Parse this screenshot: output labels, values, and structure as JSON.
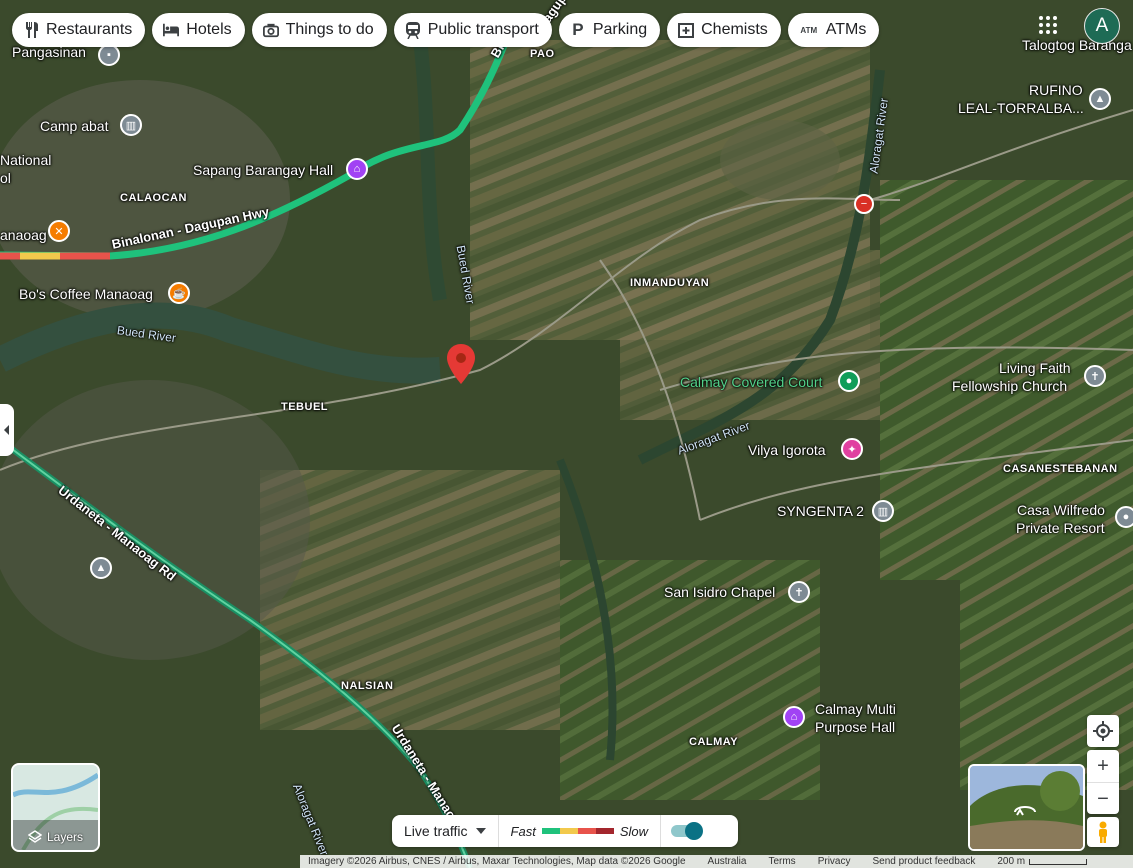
{
  "chips": [
    {
      "label": "Restaurants",
      "icon": "restaurant-icon"
    },
    {
      "label": "Hotels",
      "icon": "hotel-icon"
    },
    {
      "label": "Things to do",
      "icon": "camera-icon"
    },
    {
      "label": "Public transport",
      "icon": "train-icon"
    },
    {
      "label": "Parking",
      "icon": "parking-icon"
    },
    {
      "label": "Chemists",
      "icon": "pharmacy-icon"
    },
    {
      "label": "ATMs",
      "icon": "atm-icon"
    }
  ],
  "account": {
    "initial": "A"
  },
  "places": {
    "pangasinan": "Pangasinan",
    "camp_abat": "Camp abat",
    "national": "National",
    "national_2": "ol",
    "sapang": "Sapang Barangay Hall",
    "manaoag": "anaoag",
    "bos_coffee": "Bo's Coffee Manaoag",
    "talogtog": "Talogtog Baranga",
    "rufino_1": "RUFINO",
    "rufino_2": "LEAL-TORRALBA...",
    "calmay_court": "Calmay Covered Court",
    "living_faith_1": "Living Faith",
    "living_faith_2": "Fellowship Church",
    "vilya": "Vilya Igorota",
    "syngenta": "SYNGENTA 2",
    "casa_1": "Casa Wilfredo",
    "casa_2": "Private Resort",
    "san_isidro": "San Isidro Chapel",
    "calmay_hall_1": "Calmay Multi",
    "calmay_hall_2": "Purpose Hall"
  },
  "areas": {
    "pao": "PAO",
    "calaocan": "CALAOCAN",
    "inmanduyan": "INMANDUYAN",
    "tebuel": "TEBUEL",
    "casanestebanan": "CASANESTEBANAN",
    "nalsian": "NALSIAN",
    "calmay": "CALMAY"
  },
  "roads": {
    "binalonan_top": "Bin",
    "binalonan_main": "Binalonan - Dagupan Hwy",
    "dagupan_top": "Dagup",
    "urdaneta_1": "Urdaneta - Manaoag Rd",
    "urdaneta_2": "Urdaneta - Manaoa"
  },
  "rivers": {
    "bued_1": "Bued River",
    "bued_2": "Bued River",
    "aloragat_1": "Aloragat River",
    "aloragat_2": "Aloragat River",
    "aloragat_3": "Aloragat River"
  },
  "layers_label": "Layers",
  "traffic": {
    "dropdown": "Live traffic",
    "fast": "Fast",
    "slow": "Slow",
    "toggle_on": true,
    "scale_colors": [
      "#1fc27c",
      "#f2c94c",
      "#e8534b",
      "#a3262d"
    ]
  },
  "footer": {
    "imagery": "Imagery ©2026 Airbus, CNES / Airbus, Maxar Technologies, Map data ©2026 Google",
    "country": "Australia",
    "terms": "Terms",
    "privacy": "Privacy",
    "feedback": "Send product feedback",
    "scale": "200 m"
  },
  "colors": {
    "pin_red": "#e53935",
    "traffic_green": "#1fc27c",
    "poi_purple": "#a142f4",
    "poi_gray": "#7e8b94",
    "poi_orange": "#f57c00",
    "poi_green": "#0f9d58",
    "poi_pink": "#e040a0"
  }
}
